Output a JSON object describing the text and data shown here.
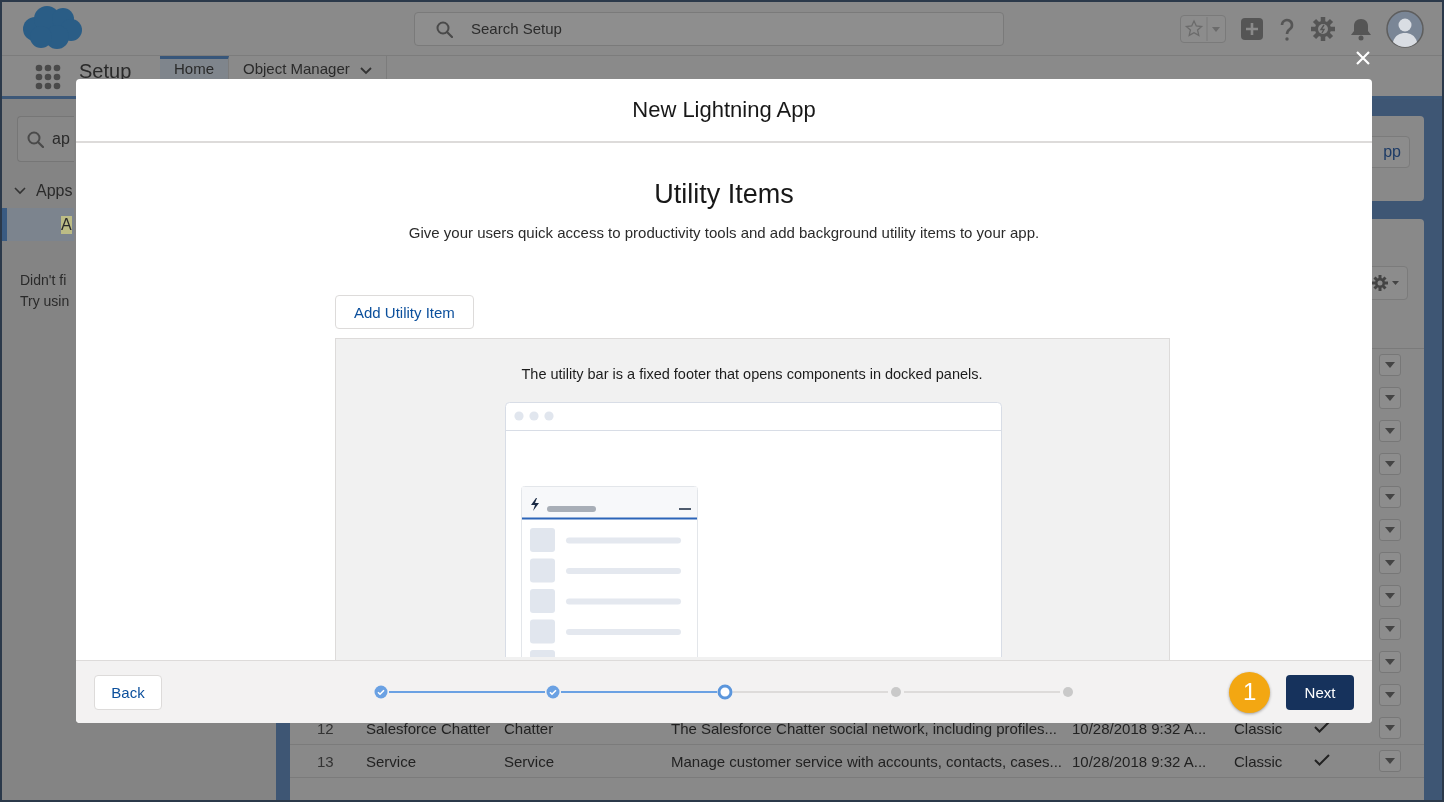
{
  "header": {
    "search": {
      "placeholder": "Search Setup"
    }
  },
  "nav": {
    "app_name": "Setup",
    "tabs": [
      {
        "label": "Home",
        "selected": true,
        "has_menu": false
      },
      {
        "label": "Object Manager",
        "selected": false,
        "has_menu": true
      }
    ]
  },
  "sidebar": {
    "search": {
      "value": "ap"
    },
    "tree": [
      {
        "label": "Apps",
        "expanded": true,
        "children": [
          {
            "label": "A",
            "selected": true
          }
        ]
      }
    ],
    "help_lines": [
      "Didn't fi",
      "Try usin"
    ]
  },
  "content": {
    "header_button": "pp",
    "table": {
      "rows": [
        {
          "covered": true
        },
        {
          "covered": true
        },
        {
          "covered": true
        },
        {
          "covered": true
        },
        {
          "covered": true
        },
        {
          "covered": true
        },
        {
          "covered": true
        },
        {
          "covered": true
        },
        {
          "covered": true
        },
        {
          "covered": true
        },
        {
          "covered": true
        },
        {
          "covered": false,
          "cells": [
            "12",
            "Salesforce Chatter",
            "Chatter",
            "The Salesforce Chatter social network, including profiles...",
            "10/28/2018 9:32 A...",
            "Classic"
          ],
          "checked": true
        },
        {
          "covered": false,
          "cells": [
            "13",
            "Service",
            "Service",
            "Manage customer service with accounts, contacts, cases...",
            "10/28/2018 9:32 A...",
            "Classic"
          ],
          "checked": true
        }
      ]
    }
  },
  "modal": {
    "title": "New Lightning App",
    "heading": "Utility Items",
    "description": "Give your users quick access to productivity tools and add background utility items to your app.",
    "add_button": "Add Utility Item",
    "panel_text": "The utility bar is a fixed footer that opens components in docked panels.",
    "footer": {
      "back": "Back",
      "steps": [
        {
          "completed": true,
          "current": false
        },
        {
          "completed": true,
          "current": false
        },
        {
          "completed": false,
          "current": true
        },
        {
          "completed": false,
          "current": false
        },
        {
          "completed": false,
          "current": false
        }
      ],
      "callout": "1",
      "next": "Next"
    }
  }
}
